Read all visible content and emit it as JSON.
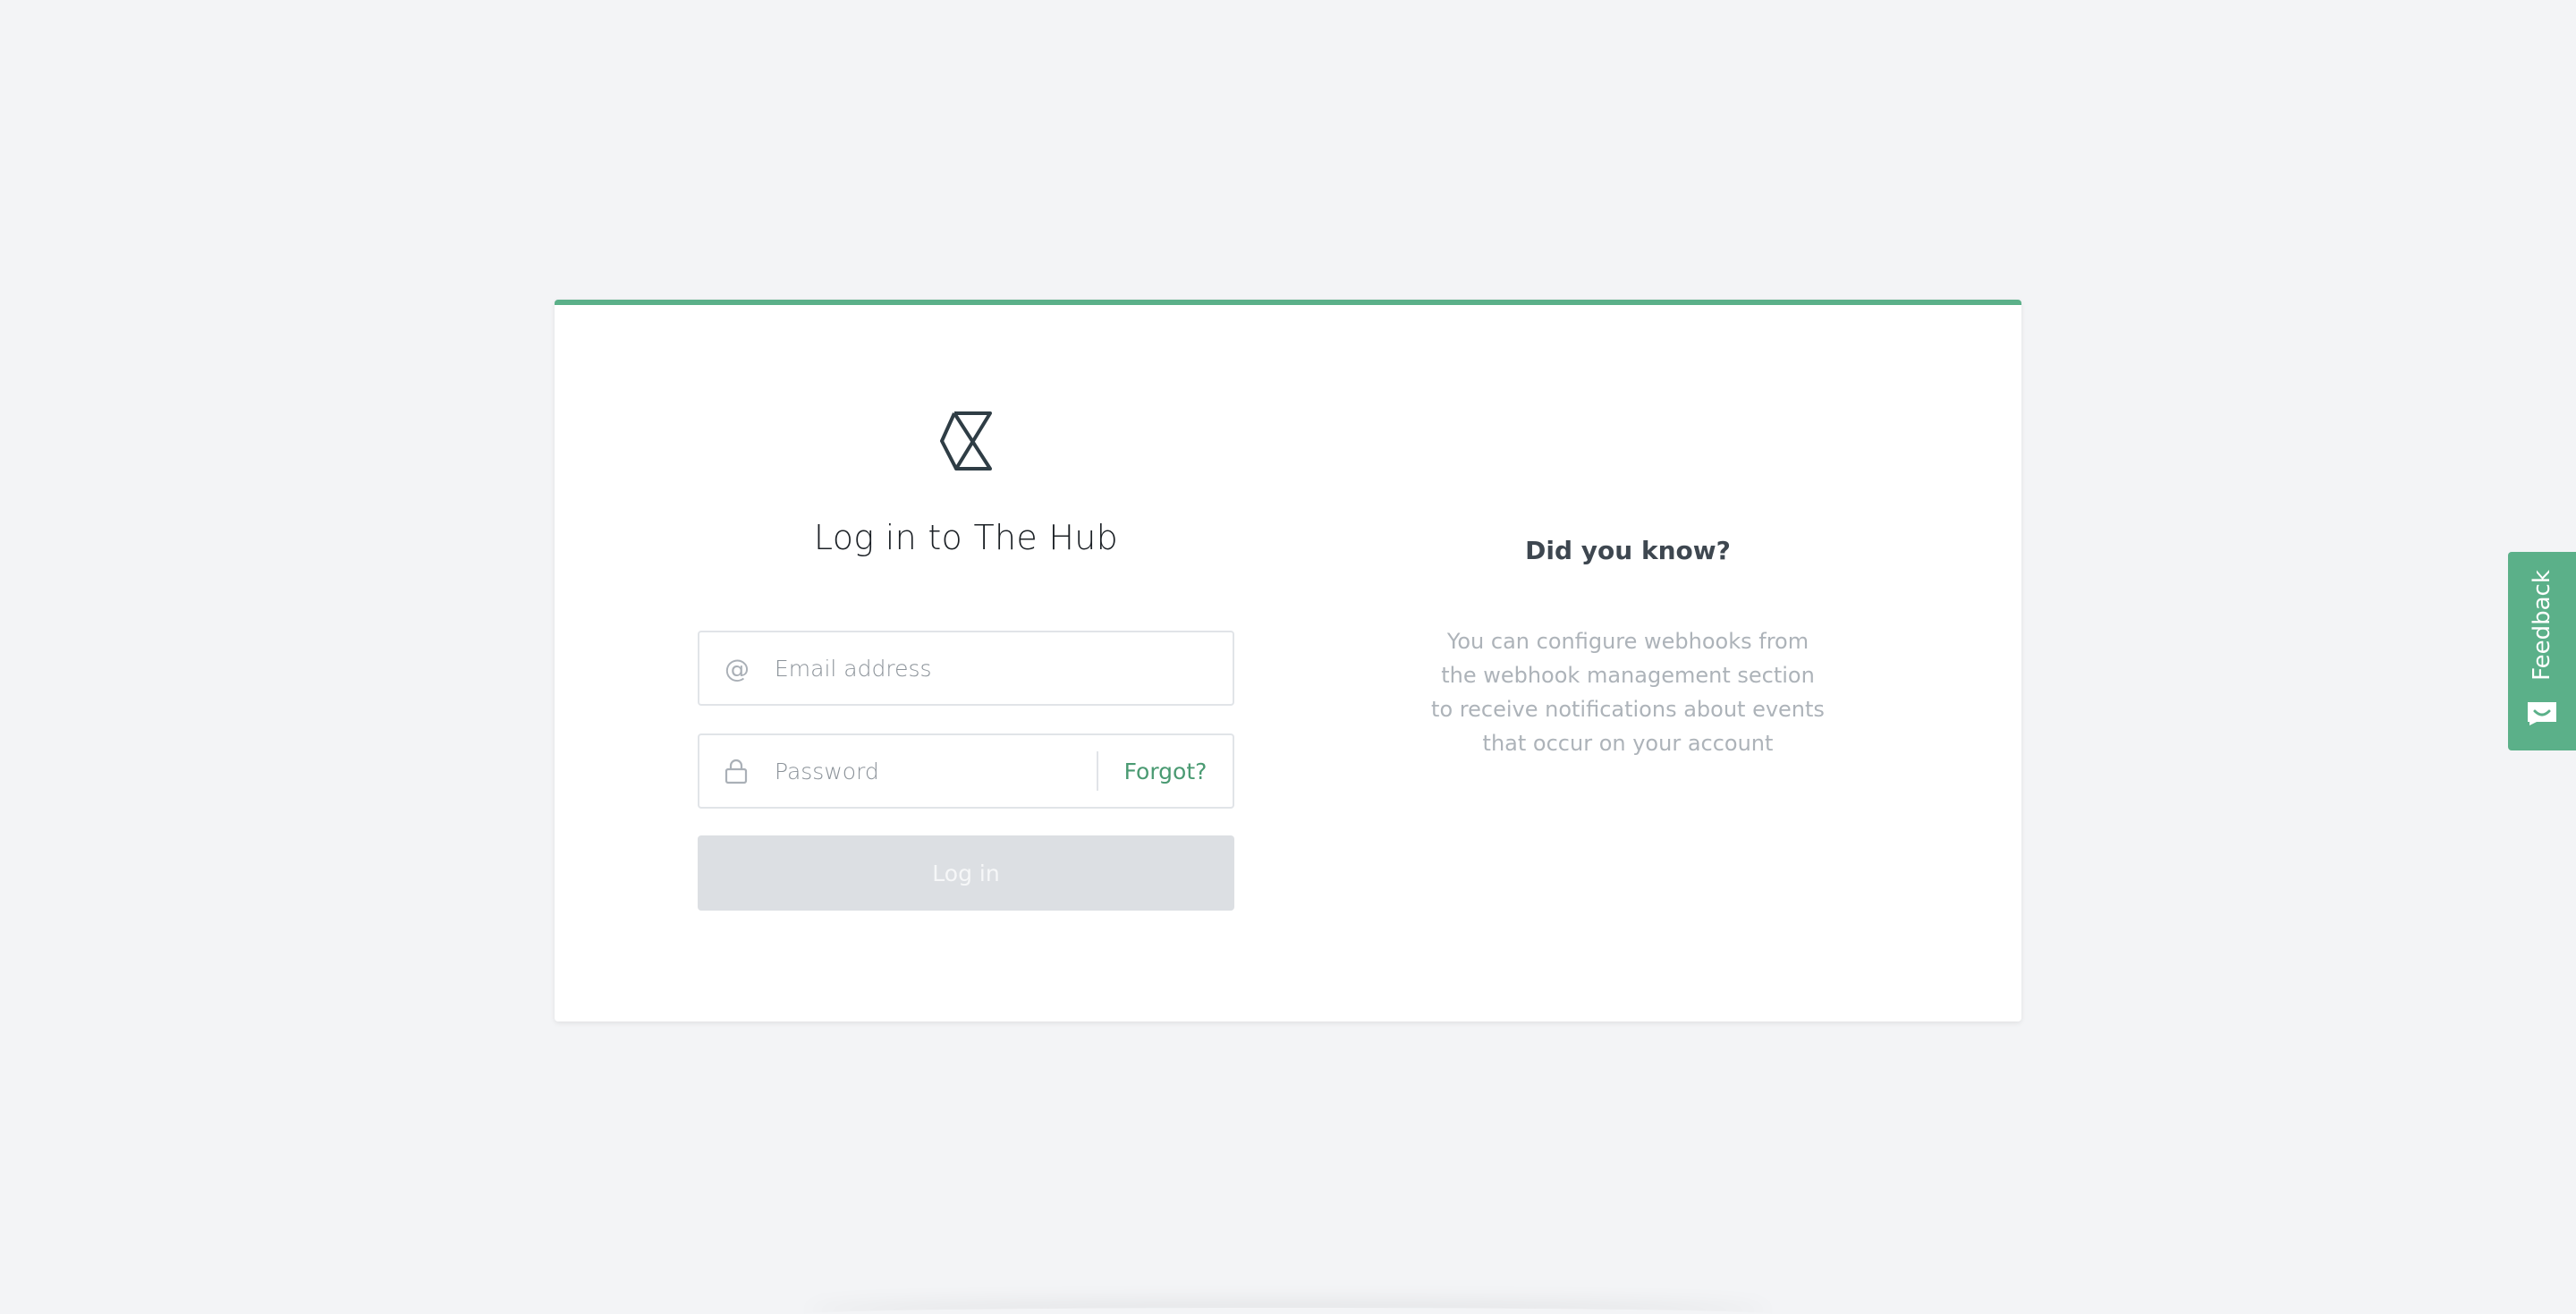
{
  "login": {
    "title": "Log in to The Hub",
    "email_placeholder": "Email address",
    "password_placeholder": "Password",
    "forgot_label": "Forgot?",
    "submit_label": "Log in"
  },
  "tip": {
    "title": "Did you know?",
    "text": "You can configure webhooks from the webhook management section to receive notifications about events that occur on your account"
  },
  "feedback": {
    "label": "Feedback"
  },
  "colors": {
    "accent": "#5bb089",
    "link": "#4a9a72",
    "background": "#f3f4f6",
    "button_disabled": "#dcdfe3"
  },
  "icons": {
    "logo": "hub-logo-icon",
    "email": "at-sign-icon",
    "password": "lock-icon",
    "feedback": "chat-face-icon"
  }
}
